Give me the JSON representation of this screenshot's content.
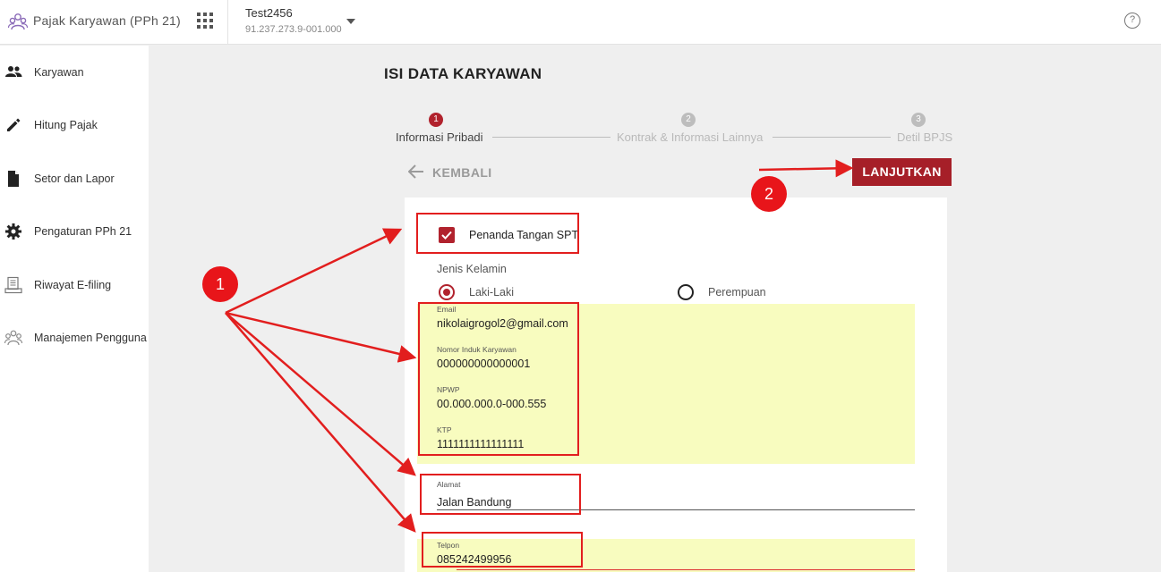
{
  "app": {
    "title": "Pajak Karyawan (PPh 21)"
  },
  "company": {
    "name": "Test2456",
    "npwp": "91.237.273.9-001.000"
  },
  "help": {
    "glyph": "?"
  },
  "sidebar": {
    "items": [
      {
        "label": "Karyawan",
        "icon": "people-icon"
      },
      {
        "label": "Hitung Pajak",
        "icon": "pencil-icon"
      },
      {
        "label": "Setor dan Lapor",
        "icon": "document-icon"
      },
      {
        "label": "Pengaturan PPh 21",
        "icon": "gear-icon"
      },
      {
        "label": "Riwayat E-filing",
        "icon": "history-icon"
      },
      {
        "label": "Manajemen Pengguna",
        "icon": "users-icon"
      }
    ]
  },
  "page": {
    "title": "ISI DATA KARYAWAN"
  },
  "stepper": {
    "steps": [
      {
        "number": "1",
        "label": "Informasi Pribadi",
        "state": "active"
      },
      {
        "number": "2",
        "label": "Kontrak & Informasi Lainnya",
        "state": "inactive"
      },
      {
        "number": "3",
        "label": "Detil BPJS",
        "state": "inactive"
      }
    ]
  },
  "actions": {
    "back_label": "KEMBALI",
    "next_label": "LANJUTKAN"
  },
  "form": {
    "signer_checkbox": {
      "label": "Penanda Tangan SPT",
      "checked": true
    },
    "gender": {
      "label": "Jenis Kelamin",
      "options": [
        {
          "label": "Laki-Laki",
          "selected": true
        },
        {
          "label": "Perempuan",
          "selected": false
        }
      ]
    },
    "email": {
      "caption": "Email",
      "value": "nikolaigrogol2@gmail.com"
    },
    "employee_id": {
      "caption": "Nomor Induk Karyawan",
      "value": "000000000000001"
    },
    "npwp": {
      "caption": "NPWP",
      "value": "00.000.000.0-000.555"
    },
    "ktp": {
      "caption": "KTP",
      "value": "1111111111111111"
    },
    "address": {
      "caption": "Alamat",
      "value": "Jalan Bandung"
    },
    "phone": {
      "caption": "Telpon",
      "value": "085242499956"
    }
  },
  "annotations": {
    "marker_1": "1",
    "marker_2": "2",
    "color": "#e21e1e"
  },
  "colors": {
    "brand": "#b1222d",
    "button": "#a61f28",
    "highlight": "#f8fcbf"
  }
}
